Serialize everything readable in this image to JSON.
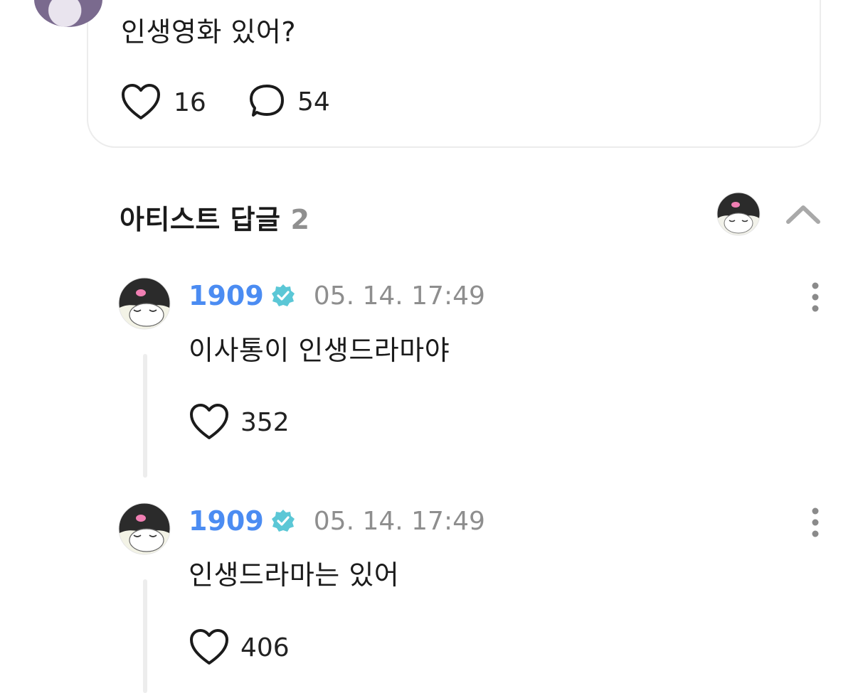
{
  "post": {
    "text": "인생영화 있어?",
    "likes": "16",
    "comments": "54"
  },
  "section": {
    "title": "아티스트 답글",
    "count": "2"
  },
  "replies": [
    {
      "author": "1909",
      "time": "05. 14. 17:49",
      "text": "이사통이 인생드라마야",
      "likes": "352"
    },
    {
      "author": "1909",
      "time": "05. 14. 17:49",
      "text": "인생드라마는 있어",
      "likes": "406"
    }
  ],
  "colors": {
    "author": "#4b8cf2",
    "verified_badge": "#5bc7d6",
    "muted": "#8e8e8e"
  }
}
